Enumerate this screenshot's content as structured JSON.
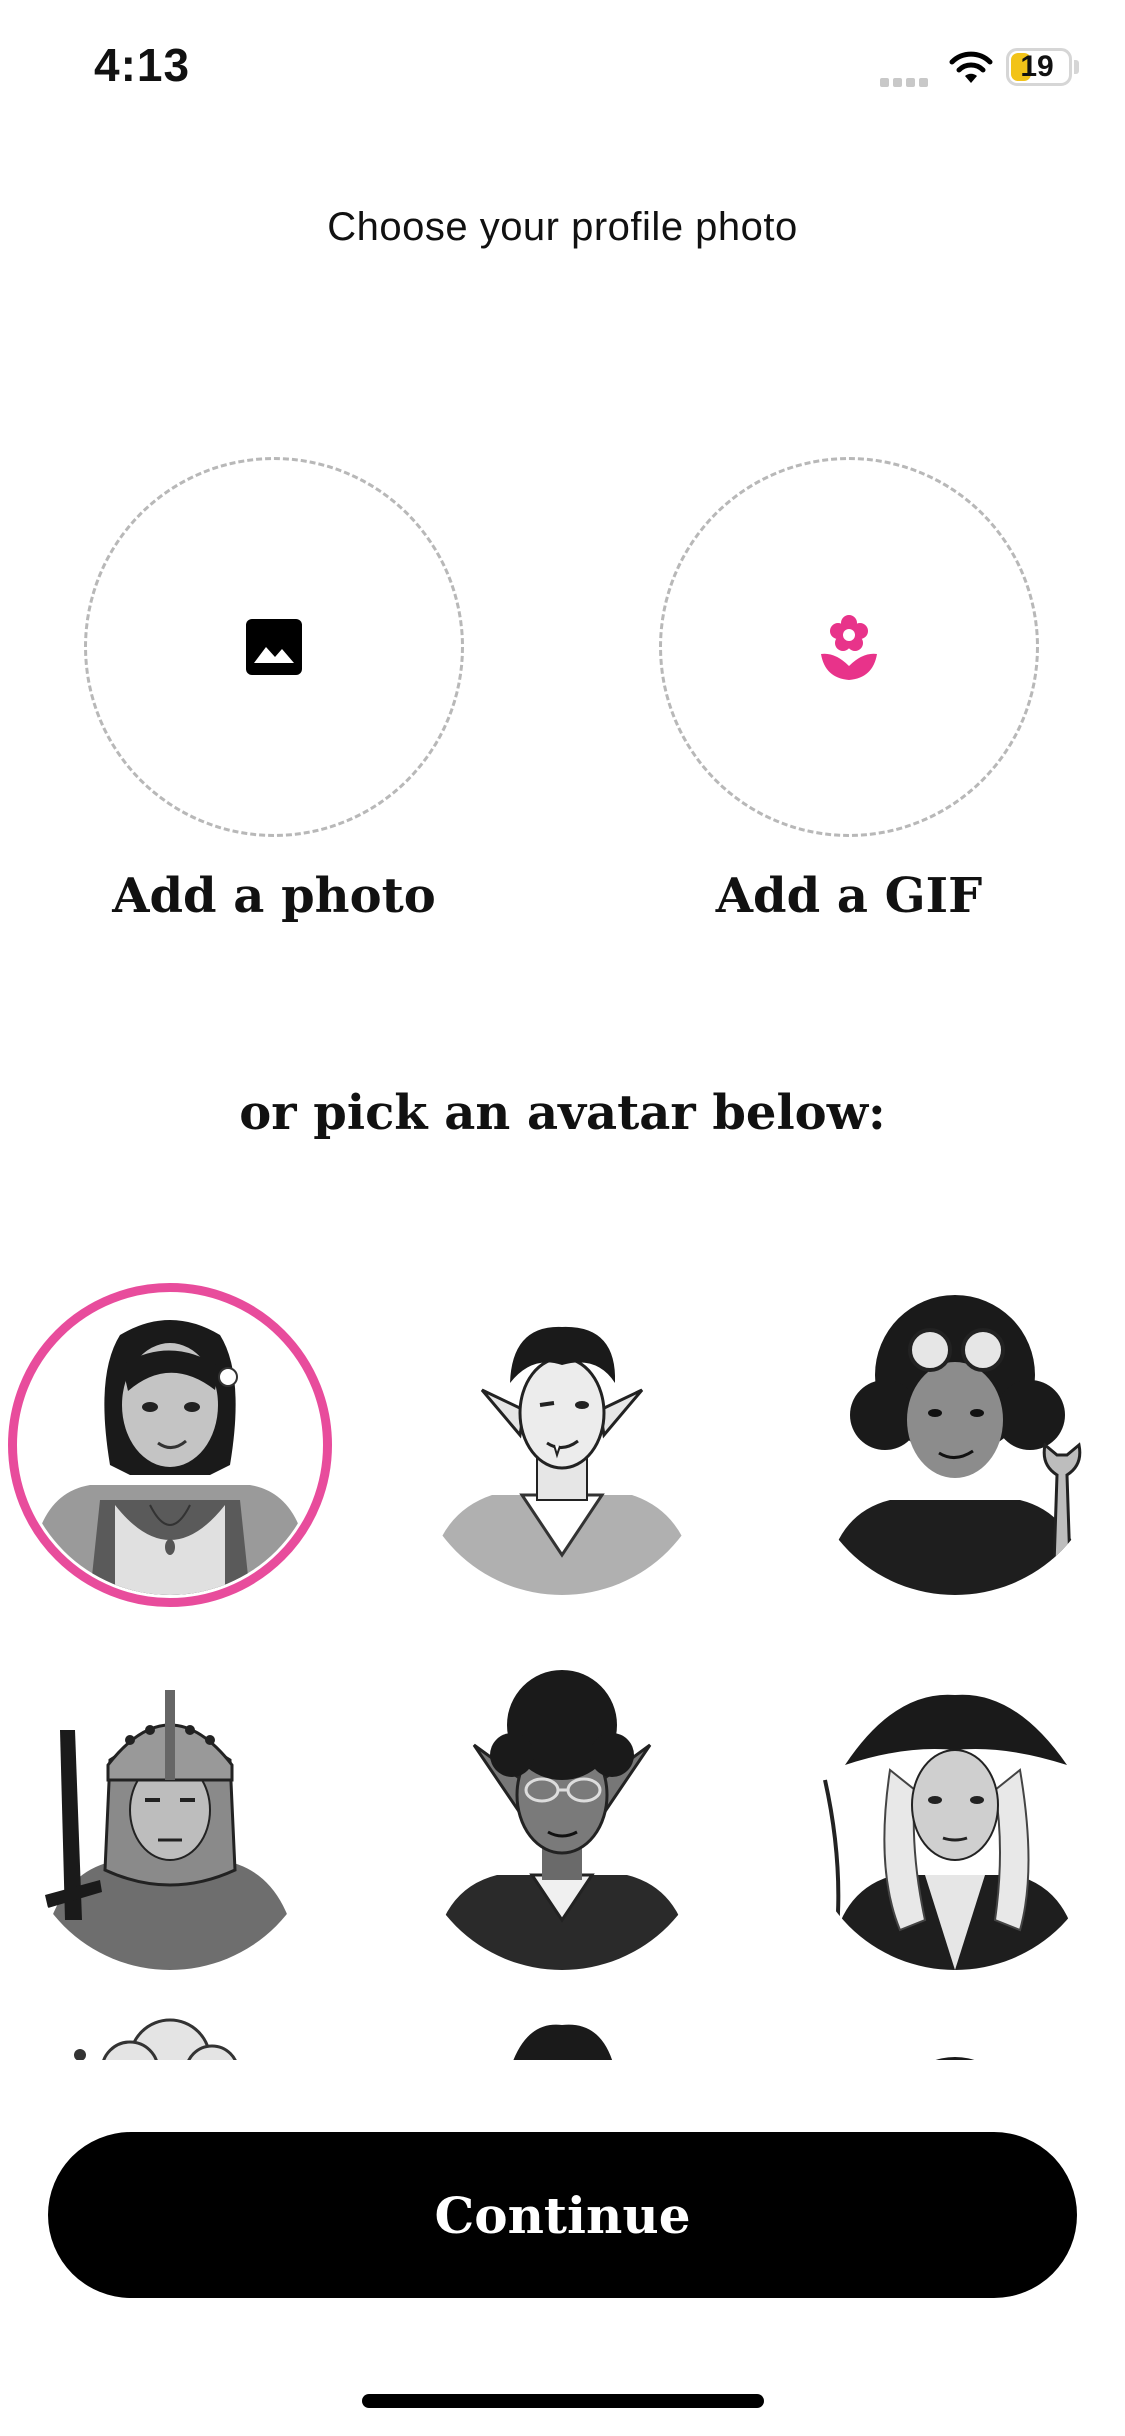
{
  "status_bar": {
    "time": "4:13",
    "battery_percent": "19",
    "battery_color": "#f2c318"
  },
  "header": {
    "title": "Choose your profile photo"
  },
  "upload": {
    "photo": {
      "label": "Add a photo",
      "icon": "image-icon"
    },
    "gif": {
      "label": "Add a GIF",
      "icon": "flower-icon",
      "icon_color": "#e8338a"
    }
  },
  "avatar_section": {
    "heading": "or pick an avatar below:",
    "selected_index": 0,
    "accent_color": "#e84c9c",
    "avatars": [
      {
        "name": "avatar-girl-flower"
      },
      {
        "name": "avatar-elf-fangs"
      },
      {
        "name": "avatar-goggles-wrench"
      },
      {
        "name": "avatar-knight-helmet"
      },
      {
        "name": "avatar-elf-glasses"
      },
      {
        "name": "avatar-pirate-hat"
      },
      {
        "name": "avatar-partial-7"
      },
      {
        "name": "avatar-partial-8"
      },
      {
        "name": "avatar-partial-9"
      }
    ]
  },
  "footer": {
    "continue_label": "Continue"
  }
}
